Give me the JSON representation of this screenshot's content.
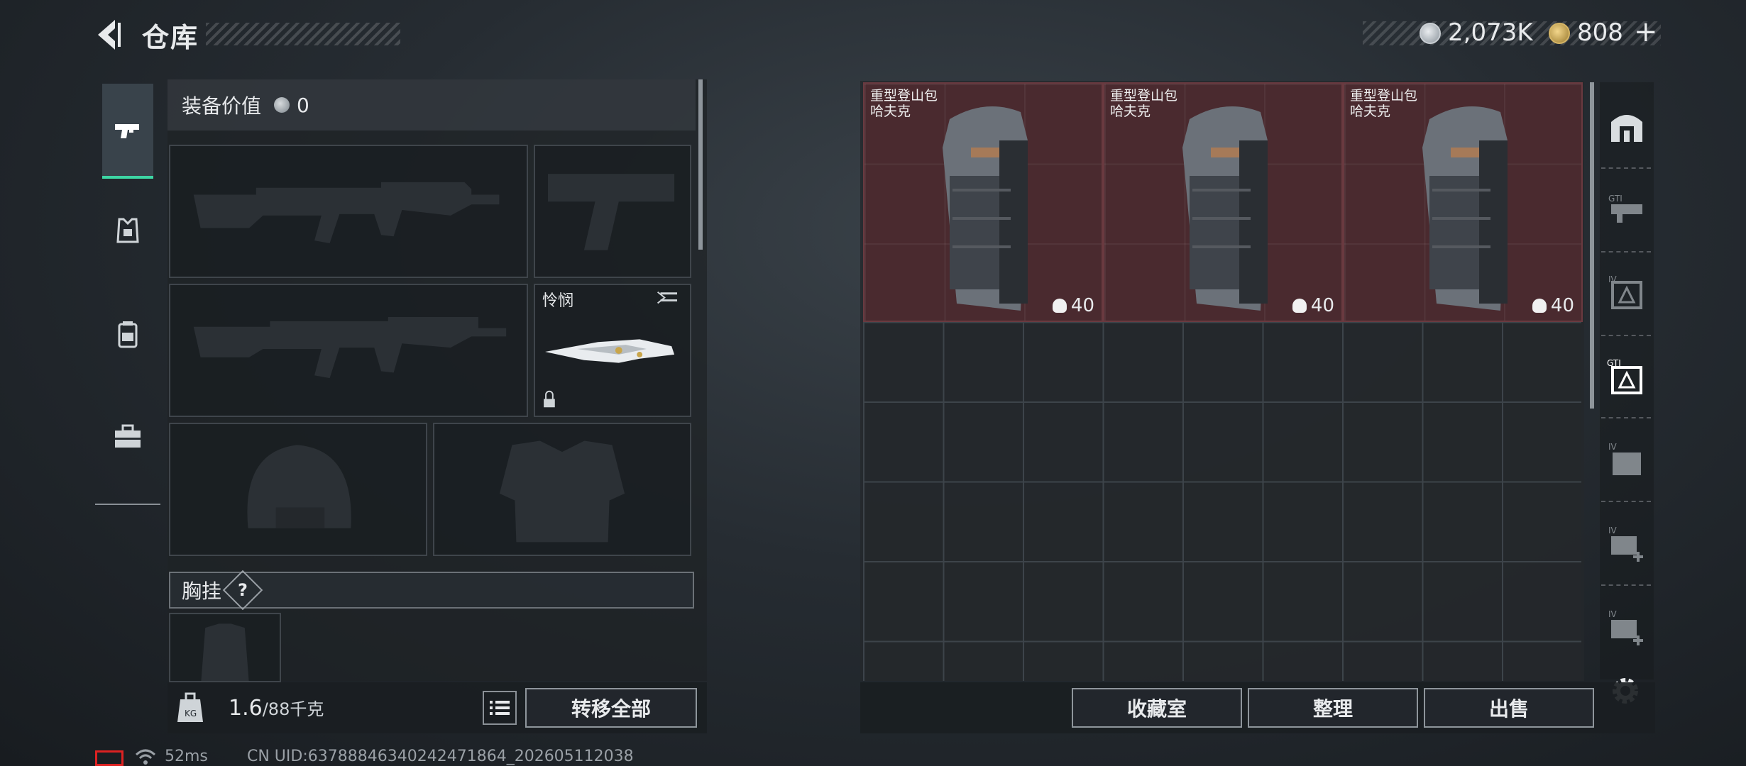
{
  "header": {
    "title": "仓库",
    "currency_silver": "2,073K",
    "currency_gold": "808",
    "plus": "+"
  },
  "left_tabs": [
    {
      "name": "weapons-tab",
      "icon": "pistol-icon",
      "active": true
    },
    {
      "name": "armor-tab",
      "icon": "vest-icon",
      "active": false
    },
    {
      "name": "backpack-tab",
      "icon": "backpack-icon",
      "active": false
    },
    {
      "name": "toolbox-tab",
      "icon": "toolbox-icon",
      "active": false
    }
  ],
  "loadout": {
    "equipment_value_label": "装备价值",
    "equipment_value": "0",
    "knife_name": "怜悯",
    "chest_rig_label": "胸挂",
    "chest_rig_help": "?",
    "weight_current": "1.6",
    "weight_max": "/88千克",
    "transfer_all": "转移全部"
  },
  "storage": {
    "items": [
      {
        "name_line1": "重型登山包",
        "name_line2": "哈夫克",
        "weight": "40"
      },
      {
        "name_line1": "重型登山包",
        "name_line2": "哈夫克",
        "weight": "40"
      },
      {
        "name_line1": "重型登山包",
        "name_line2": "哈夫克",
        "weight": "40"
      }
    ],
    "buttons": {
      "collection": "收藏室",
      "sort": "整理",
      "sell": "出售"
    }
  },
  "right_column_icons": [
    "home-storage-icon",
    "storage-gti-icon",
    "storage-iv-icon",
    "storage-gti-active-icon",
    "storage-iv-folder-icon",
    "storage-iv-add-icon",
    "storage-iv-add2-icon",
    "settings-gear-icon"
  ],
  "footer": {
    "ping": "52ms",
    "uid": "CN UID:637888463402424718​64_202605112038"
  },
  "colors": {
    "accent": "#3dd5a3",
    "item_bg": "#4a2a2f",
    "record": "#dd2222"
  }
}
